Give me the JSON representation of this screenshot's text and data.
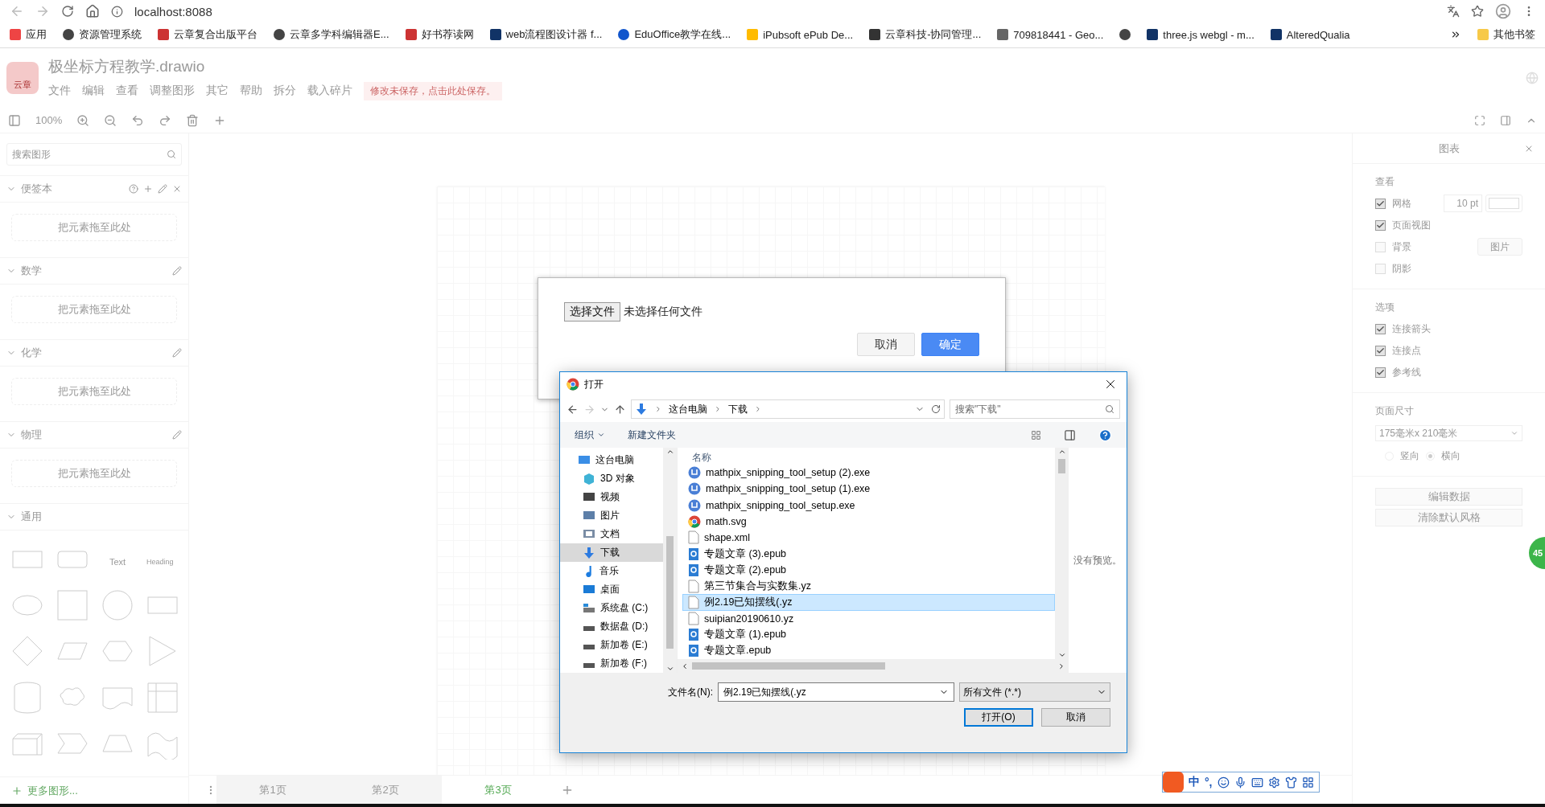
{
  "browser": {
    "url": "localhost:8088",
    "bookmarks": [
      {
        "label": "应用",
        "kind": "apps"
      },
      {
        "label": "资源管理系统",
        "kind": "globe"
      },
      {
        "label": "云章复合出版平台",
        "kind": "cloud"
      },
      {
        "label": "云章多学科编辑器E...",
        "kind": "globe"
      },
      {
        "label": "好书荐读网",
        "kind": "cloud"
      },
      {
        "label": "web流程图设计器 f...",
        "kind": "square"
      },
      {
        "label": "EduOffice教学在线...",
        "kind": "ring"
      },
      {
        "label": "iPubsoft ePub De...",
        "kind": "bar"
      },
      {
        "label": "云章科技-协同管理...",
        "kind": "text"
      },
      {
        "label": "709818441 - Geo...",
        "kind": "gear"
      },
      {
        "kind": "globe"
      },
      {
        "label": "three.js webgl - m...",
        "kind": "square"
      },
      {
        "label": "AlteredQualia",
        "kind": "square"
      }
    ],
    "other_bookmarks": "其他书签"
  },
  "app": {
    "logo": "云章",
    "title": "极坐标方程教学.drawio",
    "menu": [
      "文件",
      "编辑",
      "查看",
      "调整图形",
      "其它",
      "帮助",
      "拆分",
      "载入碎片"
    ],
    "save_notice": "修改未保存，点击此处保存。",
    "zoom": "100%"
  },
  "sidebar": {
    "search_placeholder": "搜索图形",
    "sections": [
      {
        "title": "便签本",
        "kind": "scratchpad",
        "expanded": true,
        "drop_hint": "把元素拖至此处"
      },
      {
        "title": "数学",
        "kind": "library",
        "expanded": true,
        "drop_hint": "把元素拖至此处"
      },
      {
        "title": "化学",
        "kind": "library",
        "expanded": true,
        "drop_hint": "把元素拖至此处"
      },
      {
        "title": "物理",
        "kind": "library",
        "expanded": true,
        "drop_hint": "把元素拖至此处"
      },
      {
        "title": "通用",
        "kind": "shapes",
        "expanded": true
      }
    ],
    "shape_text": "Text",
    "shape_heading": "Heading",
    "more_shapes": "更多图形..."
  },
  "pages": [
    {
      "label": "第1页",
      "selected": false
    },
    {
      "label": "第2页",
      "selected": false
    },
    {
      "label": "第3页",
      "selected": true
    }
  ],
  "format_panel": {
    "title": "图表",
    "view_title": "查看",
    "view_options": [
      {
        "label": "网格",
        "checked": true
      },
      {
        "label": "页面视图",
        "checked": true
      },
      {
        "label": "背景",
        "checked": false
      },
      {
        "label": "阴影",
        "checked": false
      }
    ],
    "grid_size": "10 pt",
    "image_button": "图片",
    "options_title": "选项",
    "options": [
      {
        "label": "连接箭头",
        "checked": true
      },
      {
        "label": "连接点",
        "checked": true
      },
      {
        "label": "参考线",
        "checked": true
      }
    ],
    "page_size_title": "页面尺寸",
    "page_size": "175毫米x 210毫米",
    "orientations": [
      {
        "label": "竖向",
        "selected": false
      },
      {
        "label": "横向",
        "selected": true
      }
    ],
    "buttons": [
      "编辑数据",
      "清除默认风格"
    ]
  },
  "import_dialog": {
    "choose_button": "选择文件",
    "no_file": "未选择任何文件",
    "cancel": "取消",
    "ok": "确定"
  },
  "file_dialog": {
    "title": "打开",
    "path": [
      "这台电脑",
      "下载"
    ],
    "search_placeholder": "搜索\"下载\"",
    "commands": [
      "组织",
      "新建文件夹"
    ],
    "nav": [
      {
        "label": "这台电脑",
        "kind": "computer",
        "selected": false,
        "children": [
          {
            "label": "3D 对象",
            "kind": "cube",
            "selected": false
          },
          {
            "label": "视频",
            "kind": "film",
            "selected": false
          },
          {
            "label": "图片",
            "kind": "image",
            "selected": false
          },
          {
            "label": "文档",
            "kind": "document",
            "selected": false
          },
          {
            "label": "下载",
            "kind": "download",
            "selected": true
          },
          {
            "label": "音乐",
            "kind": "music",
            "selected": false
          },
          {
            "label": "桌面",
            "kind": "desktop",
            "selected": false
          },
          {
            "label": "系统盘 (C:)",
            "kind": "system-drive",
            "selected": false
          },
          {
            "label": "数据盘 (D:)",
            "kind": "drive",
            "selected": false
          },
          {
            "label": "新加卷 (E:)",
            "kind": "drive",
            "selected": false
          },
          {
            "label": "新加卷 (F:)",
            "kind": "drive",
            "selected": false
          }
        ]
      }
    ],
    "column": "名称",
    "files": [
      {
        "name": "mathpix_snipping_tool_setup (2).exe",
        "kind": "app",
        "selected": false
      },
      {
        "name": "mathpix_snipping_tool_setup (1).exe",
        "kind": "app",
        "selected": false
      },
      {
        "name": "mathpix_snipping_tool_setup.exe",
        "kind": "app",
        "selected": false
      },
      {
        "name": "math.svg",
        "kind": "browser",
        "selected": false
      },
      {
        "name": "shape.xml",
        "kind": "blank",
        "selected": false
      },
      {
        "name": "专题文章 (3).epub",
        "kind": "ebook",
        "selected": false
      },
      {
        "name": "专题文章 (2).epub",
        "kind": "ebook",
        "selected": false
      },
      {
        "name": "第三节集合与实数集.yz",
        "kind": "blank",
        "selected": false
      },
      {
        "name": "例2.19已知摆线(.yz",
        "kind": "blank",
        "selected": true
      },
      {
        "name": "suipian20190610.yz",
        "kind": "blank",
        "selected": false
      },
      {
        "name": "专题文章 (1).epub",
        "kind": "ebook",
        "selected": false
      },
      {
        "name": "专题文章.epub",
        "kind": "ebook",
        "selected": false
      }
    ],
    "preview": "没有预览。",
    "filename_label": "文件名(N):",
    "filename": "例2.19已知摆线(.yz",
    "filetype": "所有文件 (*.*)",
    "open": "打开(O)",
    "cancel": "取消"
  },
  "ime": {
    "mode": "中",
    "punct": "°,"
  },
  "badge": "45"
}
